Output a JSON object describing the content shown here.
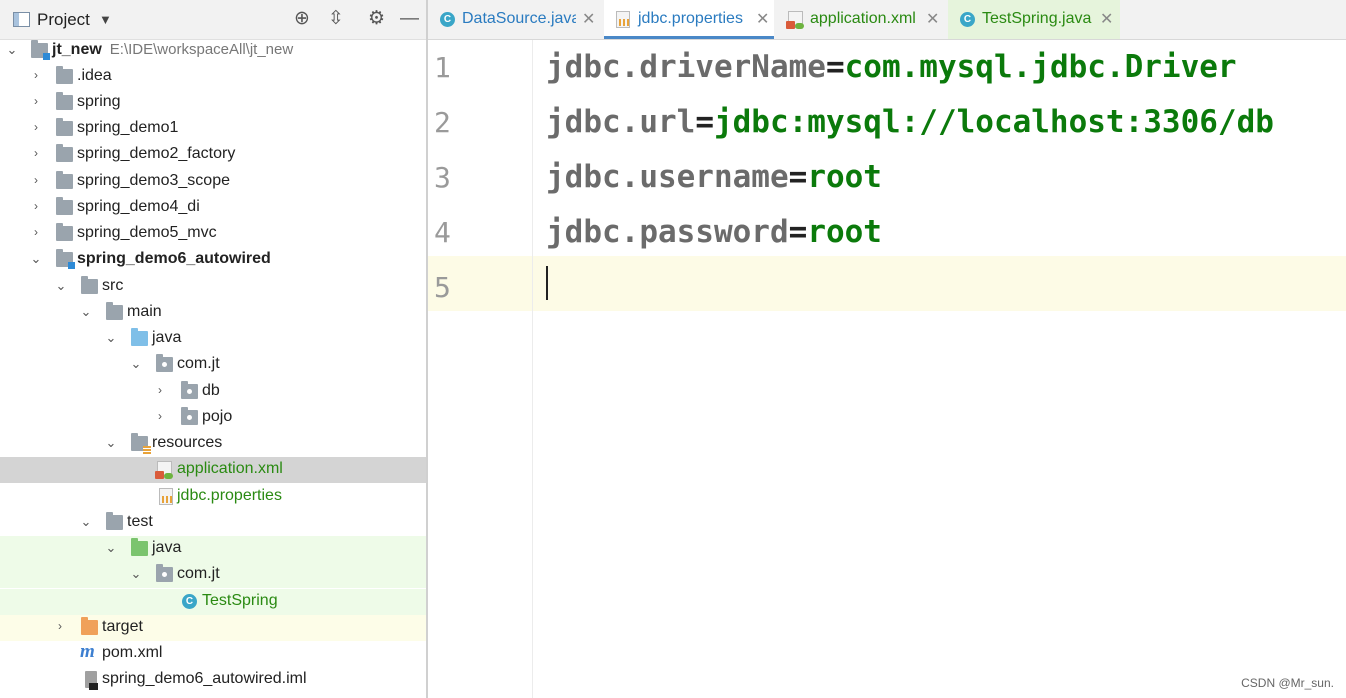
{
  "project_panel": {
    "title": "Project",
    "tree": [
      {
        "label": "jt_new",
        "path": "E:\\IDE\\workspaceAll\\jt_new"
      },
      {
        "label": ".idea"
      },
      {
        "label": "spring"
      },
      {
        "label": "spring_demo1"
      },
      {
        "label": "spring_demo2_factory"
      },
      {
        "label": "spring_demo3_scope"
      },
      {
        "label": "spring_demo4_di"
      },
      {
        "label": "spring_demo5_mvc"
      },
      {
        "label": "spring_demo6_autowired"
      },
      {
        "label": "src"
      },
      {
        "label": "main"
      },
      {
        "label": "java"
      },
      {
        "label": "com.jt"
      },
      {
        "label": "db"
      },
      {
        "label": "pojo"
      },
      {
        "label": "resources"
      },
      {
        "label": "application.xml"
      },
      {
        "label": "jdbc.properties"
      },
      {
        "label": "test"
      },
      {
        "label": "java"
      },
      {
        "label": "com.jt"
      },
      {
        "label": "TestSpring"
      },
      {
        "label": "target"
      },
      {
        "label": "pom.xml"
      },
      {
        "label": "spring_demo6_autowired.iml"
      }
    ]
  },
  "tabs": [
    {
      "label": "DataSource.java",
      "icon": "class-icon"
    },
    {
      "label": "jdbc.properties",
      "icon": "properties-file-icon"
    },
    {
      "label": "application.xml",
      "icon": "xml-file-icon"
    },
    {
      "label": "TestSpring.java",
      "icon": "test-class-icon"
    }
  ],
  "editor": {
    "lines": [
      {
        "num": "1",
        "key": "jdbc.driverName",
        "eq": "=",
        "value": "com.mysql.jdbc.Driver"
      },
      {
        "num": "2",
        "key": "jdbc.url",
        "eq": "=",
        "value": "jdbc:mysql://localhost:3306/db"
      },
      {
        "num": "3",
        "key": "jdbc.username",
        "eq": "=",
        "value": "root"
      },
      {
        "num": "4",
        "key": "jdbc.password",
        "eq": "=",
        "value": "root"
      },
      {
        "num": "5",
        "key": "",
        "eq": "",
        "value": ""
      }
    ]
  },
  "watermark": "CSDN @Mr_sun.",
  "colors": {
    "accent": "#4a88c7",
    "value_green": "#0b7a0b",
    "tree_green": "#2a8a12"
  }
}
